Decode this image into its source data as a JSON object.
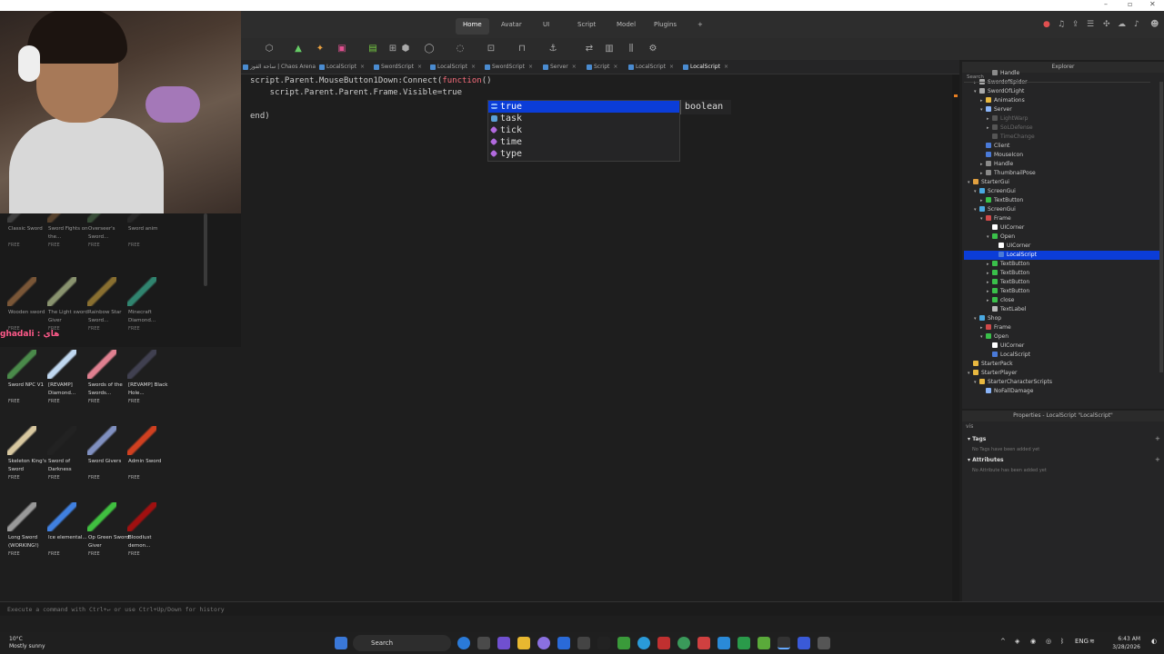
{
  "menu": {
    "tabs": [
      "Home",
      "Avatar",
      "UI",
      "Script",
      "Model",
      "Plugins"
    ],
    "active_tab": "Home"
  },
  "doc_tabs": [
    {
      "label": "ساحة الفوز | Chaos Arena",
      "active": false
    },
    {
      "label": "LocalScript",
      "active": false
    },
    {
      "label": "SwordScript",
      "active": false
    },
    {
      "label": "LocalScript",
      "active": false
    },
    {
      "label": "SwordScript",
      "active": false
    },
    {
      "label": "Server",
      "active": false
    },
    {
      "label": "Script",
      "active": false
    },
    {
      "label": "LocalScript",
      "active": false
    },
    {
      "label": "LocalScript",
      "active": true
    }
  ],
  "editor": {
    "line1_a": "script.Parent.MouseButton1Down:Connect(",
    "line1_kw": "function",
    "line1_b": "()",
    "line2": "    script.Parent.Parent.Frame.Visible=true",
    "line3": "end)"
  },
  "autocomplete": {
    "items": [
      {
        "label": "true",
        "icon": "keyword-icon"
      },
      {
        "label": "task",
        "icon": "library-icon"
      },
      {
        "label": "tick",
        "icon": "function-icon"
      },
      {
        "label": "time",
        "icon": "function-icon"
      },
      {
        "label": "type",
        "icon": "function-icon"
      }
    ],
    "selected": "true",
    "doc": "boolean"
  },
  "toolbox": {
    "items": [
      {
        "name": "Classic Sword",
        "free": "FREE",
        "color": "#555555"
      },
      {
        "name": "Sword Fights on the...",
        "free": "FREE",
        "color": "#7a5a3a"
      },
      {
        "name": "Overseer's Sword...",
        "free": "FREE",
        "color": "#4a6a4a"
      },
      {
        "name": "Sword anim",
        "free": "FREE",
        "color": "#333333"
      },
      {
        "name": "Wooden sword",
        "free": "FREE",
        "color": "#b07a4a"
      },
      {
        "name": "The Light sword Giver",
        "free": "FREE",
        "color": "#c8d8a0"
      },
      {
        "name": "Rainbow Star Sword...",
        "free": "FREE",
        "color": "#c8a040"
      },
      {
        "name": "Minecraft Diamond...",
        "free": "FREE",
        "color": "#40c0a0"
      },
      {
        "name": "Sword NPC V1",
        "free": "FREE",
        "color": "#4a8a4a"
      },
      {
        "name": "[REVAMP] Diamond...",
        "free": "FREE",
        "color": "#c0d8f0"
      },
      {
        "name": "Swords of the Swords...",
        "free": "FREE",
        "color": "#e08090"
      },
      {
        "name": "[REVAMP] Black Hole...",
        "free": "FREE",
        "color": "#404050"
      },
      {
        "name": "Skeleton King's Sword",
        "free": "FREE",
        "color": "#d8c8a0"
      },
      {
        "name": "Sword of Darkness",
        "free": "FREE",
        "color": "#222222"
      },
      {
        "name": "Sword Givers",
        "free": "FREE",
        "color": "#8090c0"
      },
      {
        "name": "Admin Sword",
        "free": "FREE",
        "color": "#d04020"
      },
      {
        "name": "Long Sword (WORKING!)",
        "free": "FREE",
        "color": "#999999"
      },
      {
        "name": "Ice elemental...",
        "free": "FREE",
        "color": "#4080e0"
      },
      {
        "name": "Op Green Sword Giver",
        "free": "FREE",
        "color": "#40c040"
      },
      {
        "name": "Bloodlust demon...",
        "free": "FREE",
        "color": "#a01010"
      }
    ],
    "chat": "ghadali : هاي"
  },
  "explorer": {
    "title": "Explorer",
    "search_placeholder": "Search",
    "rows": [
      {
        "label": "Handle",
        "indent": 3,
        "icon": "part",
        "arrow": ""
      },
      {
        "label": "SwordofSpider",
        "indent": 1,
        "icon": "tool",
        "arrow": "▸"
      },
      {
        "label": "SwordOfLight",
        "indent": 1,
        "icon": "tool",
        "arrow": "▾"
      },
      {
        "label": "Animations",
        "indent": 2,
        "icon": "folder",
        "arrow": "▸"
      },
      {
        "label": "Server",
        "indent": 2,
        "icon": "script",
        "arrow": "▾"
      },
      {
        "label": "LightWarp",
        "indent": 3,
        "icon": "dim",
        "arrow": "▸",
        "dim": true
      },
      {
        "label": "SoLDefense",
        "indent": 3,
        "icon": "dim",
        "arrow": "▸",
        "dim": true
      },
      {
        "label": "TimeChange",
        "indent": 3,
        "icon": "dim",
        "arrow": "",
        "dim": true
      },
      {
        "label": "Client",
        "indent": 2,
        "icon": "localscript",
        "arrow": ""
      },
      {
        "label": "MouseIcon",
        "indent": 2,
        "icon": "localscript",
        "arrow": ""
      },
      {
        "label": "Handle",
        "indent": 2,
        "icon": "part",
        "arrow": "▸"
      },
      {
        "label": "ThumbnailPose",
        "indent": 2,
        "icon": "pose",
        "arrow": "▸"
      },
      {
        "label": "StarterGui",
        "indent": 0,
        "icon": "gui",
        "arrow": "▾"
      },
      {
        "label": "ScreenGui",
        "indent": 1,
        "icon": "screengui",
        "arrow": "▾"
      },
      {
        "label": "TextButton",
        "indent": 2,
        "icon": "button",
        "arrow": "▸"
      },
      {
        "label": "ScreenGui",
        "indent": 1,
        "icon": "screengui",
        "arrow": "▾"
      },
      {
        "label": "Frame",
        "indent": 2,
        "icon": "frame",
        "arrow": "▾"
      },
      {
        "label": "UICorner",
        "indent": 3,
        "icon": "corner",
        "arrow": ""
      },
      {
        "label": "Open",
        "indent": 3,
        "icon": "button",
        "arrow": "▾"
      },
      {
        "label": "UICorner",
        "indent": 4,
        "icon": "corner",
        "arrow": ""
      },
      {
        "label": "LocalScript",
        "indent": 4,
        "icon": "localscript",
        "arrow": "",
        "selected": true
      },
      {
        "label": "TextButton",
        "indent": 3,
        "icon": "button",
        "arrow": "▸"
      },
      {
        "label": "TextButton",
        "indent": 3,
        "icon": "button",
        "arrow": "▸"
      },
      {
        "label": "TextButton",
        "indent": 3,
        "icon": "button",
        "arrow": "▸"
      },
      {
        "label": "TextButton",
        "indent": 3,
        "icon": "button",
        "arrow": "▸"
      },
      {
        "label": "close",
        "indent": 3,
        "icon": "button",
        "arrow": "▸"
      },
      {
        "label": "TextLabel",
        "indent": 3,
        "icon": "label",
        "arrow": ""
      },
      {
        "label": "Shop",
        "indent": 1,
        "icon": "screengui",
        "arrow": "▾"
      },
      {
        "label": "Frame",
        "indent": 2,
        "icon": "frame",
        "arrow": "▸"
      },
      {
        "label": "Open",
        "indent": 2,
        "icon": "button",
        "arrow": "▾"
      },
      {
        "label": "UICorner",
        "indent": 3,
        "icon": "corner",
        "arrow": ""
      },
      {
        "label": "LocalScript",
        "indent": 3,
        "icon": "localscript",
        "arrow": ""
      },
      {
        "label": "StarterPack",
        "indent": 0,
        "icon": "folder",
        "arrow": ""
      },
      {
        "label": "StarterPlayer",
        "indent": 0,
        "icon": "folder",
        "arrow": "▾"
      },
      {
        "label": "StarterCharacterScripts",
        "indent": 1,
        "icon": "folder",
        "arrow": "▾"
      },
      {
        "label": "NoFallDamage",
        "indent": 2,
        "icon": "script",
        "arrow": ""
      }
    ]
  },
  "properties": {
    "title": "Properties - LocalScript \"LocalScript\"",
    "filter": "vis",
    "tags_label": "Tags",
    "tags_note": "No Tags have been added yet",
    "attributes_label": "Attributes",
    "attributes_note": "No Attribute has been added yet"
  },
  "command_bar": {
    "placeholder": "Execute a command with Ctrl+↵ or use Ctrl+Up/Down for history"
  },
  "taskbar": {
    "temp": "10°C",
    "weather": "Mostly sunny",
    "search": "Search",
    "lang": "ENG",
    "time": "6:43 AM",
    "date": "3/28/2026"
  }
}
